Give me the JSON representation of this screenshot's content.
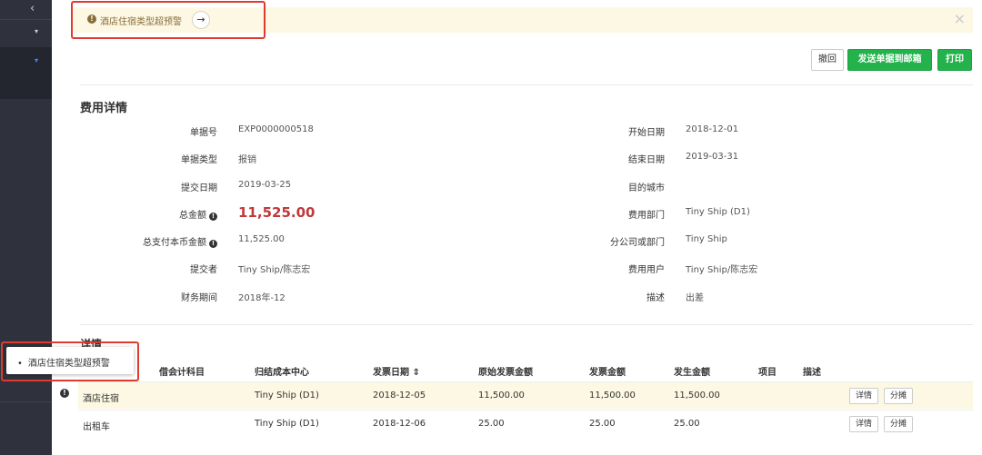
{
  "sidebar": {
    "collapse_icon": "‹",
    "menu_1_icon": "▾",
    "menu_2_icon": "▾"
  },
  "alert": {
    "text": "酒店住宿类型超预警",
    "go_icon": "→",
    "close_icon": "×",
    "warn_icon": "!"
  },
  "actions": {
    "revoke": "撤回",
    "send": "发送单据到邮箱",
    "print": "打印"
  },
  "summary": {
    "title": "费用详情",
    "left": [
      {
        "label": "单据号",
        "value": "EXP0000000518",
        "info": false
      },
      {
        "label": "单据类型",
        "value": "报销",
        "info": false
      },
      {
        "label": "提交日期",
        "value": "2019-03-25",
        "info": false
      },
      {
        "label": "总金额",
        "value": "11,525.00",
        "info": true
      },
      {
        "label": "总支付本币金额",
        "value": "11,525.00",
        "info": true
      },
      {
        "label": "提交者",
        "value": "Tiny Ship/陈志宏",
        "info": false
      },
      {
        "label": "财务期间",
        "value": "2018年-12",
        "info": false
      }
    ],
    "right": [
      {
        "label": "开始日期",
        "value": "2018-12-01"
      },
      {
        "label": "结束日期",
        "value": "2019-03-31"
      },
      {
        "label": "目的城市",
        "value": ""
      },
      {
        "label": "费用部门",
        "value": "Tiny Ship (D1)"
      },
      {
        "label": "分公司或部门",
        "value": "Tiny Ship"
      },
      {
        "label": "费用用户",
        "value": "Tiny Ship/陈志宏"
      },
      {
        "label": "描述",
        "value": "出差"
      }
    ]
  },
  "details": {
    "title": "详情",
    "headers": [
      "借会计科目",
      "归结成本中心",
      "发票日期 ⇕",
      "原始发票金额",
      "发票金额",
      "发生金额",
      "项目",
      "描述"
    ],
    "rows": [
      {
        "account": "酒店住宿",
        "cost_center": "Tiny Ship (D1)",
        "date": "2018-12-05",
        "orig_amount": "11,500.00",
        "inv_amount": "11,500.00",
        "amount": "11,500.00",
        "project": "",
        "desc": "",
        "detail_btn": "详情",
        "split_btn": "分摊"
      },
      {
        "account": "出租车",
        "cost_center": "Tiny Ship (D1)",
        "date": "2018-12-06",
        "orig_amount": "25.00",
        "inv_amount": "25.00",
        "amount": "25.00",
        "project": "",
        "desc": "",
        "detail_btn": "详情",
        "split_btn": "分摊"
      }
    ],
    "row_warn_icon": "!"
  },
  "tooltip": {
    "text": "酒店住宿类型超预警"
  },
  "colors": {
    "sidebar": "#2f323c",
    "alert_bg": "#fcf8e3",
    "primary_green": "#23b24b",
    "amount_red": "#c0393b",
    "highlight_red": "#e03a30"
  }
}
